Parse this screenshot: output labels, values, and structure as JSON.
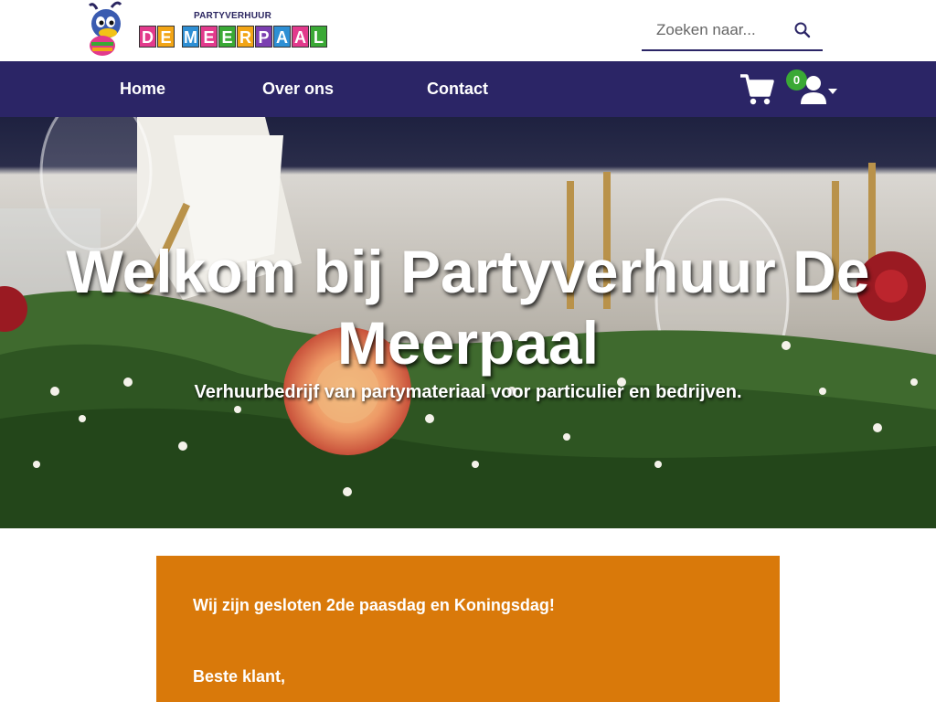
{
  "header": {
    "logo": {
      "small_text": "PARTYVERHUUR",
      "name_letters": [
        "D",
        "E",
        "",
        "M",
        "E",
        "E",
        "R",
        "P",
        "A",
        "A",
        "L"
      ],
      "letter_colors": [
        "#e23a8c",
        "#f2a516",
        "#ffffff",
        "#2e8fd4",
        "#e23a8c",
        "#3aa935",
        "#f2a516",
        "#7b3fb0",
        "#2e8fd4",
        "#e23a8c",
        "#3aa935"
      ]
    },
    "search": {
      "placeholder": "Zoeken naar...",
      "value": "",
      "icon": "search-icon"
    }
  },
  "nav": {
    "items": [
      {
        "label": "Home"
      },
      {
        "label": "Over ons"
      },
      {
        "label": "Contact"
      }
    ],
    "cart": {
      "icon": "cart-icon",
      "count": "0"
    },
    "user": {
      "icon": "user-icon"
    }
  },
  "hero": {
    "title": "Welkom bij Partyverhuur De Meerpaal",
    "subtitle": "Verhuurbedrijf van partymateriaal voor particulier en bedrijven."
  },
  "notice": {
    "title": "Wij zijn gesloten 2de paasdag en Koningsdag!",
    "greeting": "Beste klant,"
  },
  "colors": {
    "nav_bg": "#2b2566",
    "notice_bg": "#d9790a",
    "badge": "#3aa935"
  }
}
